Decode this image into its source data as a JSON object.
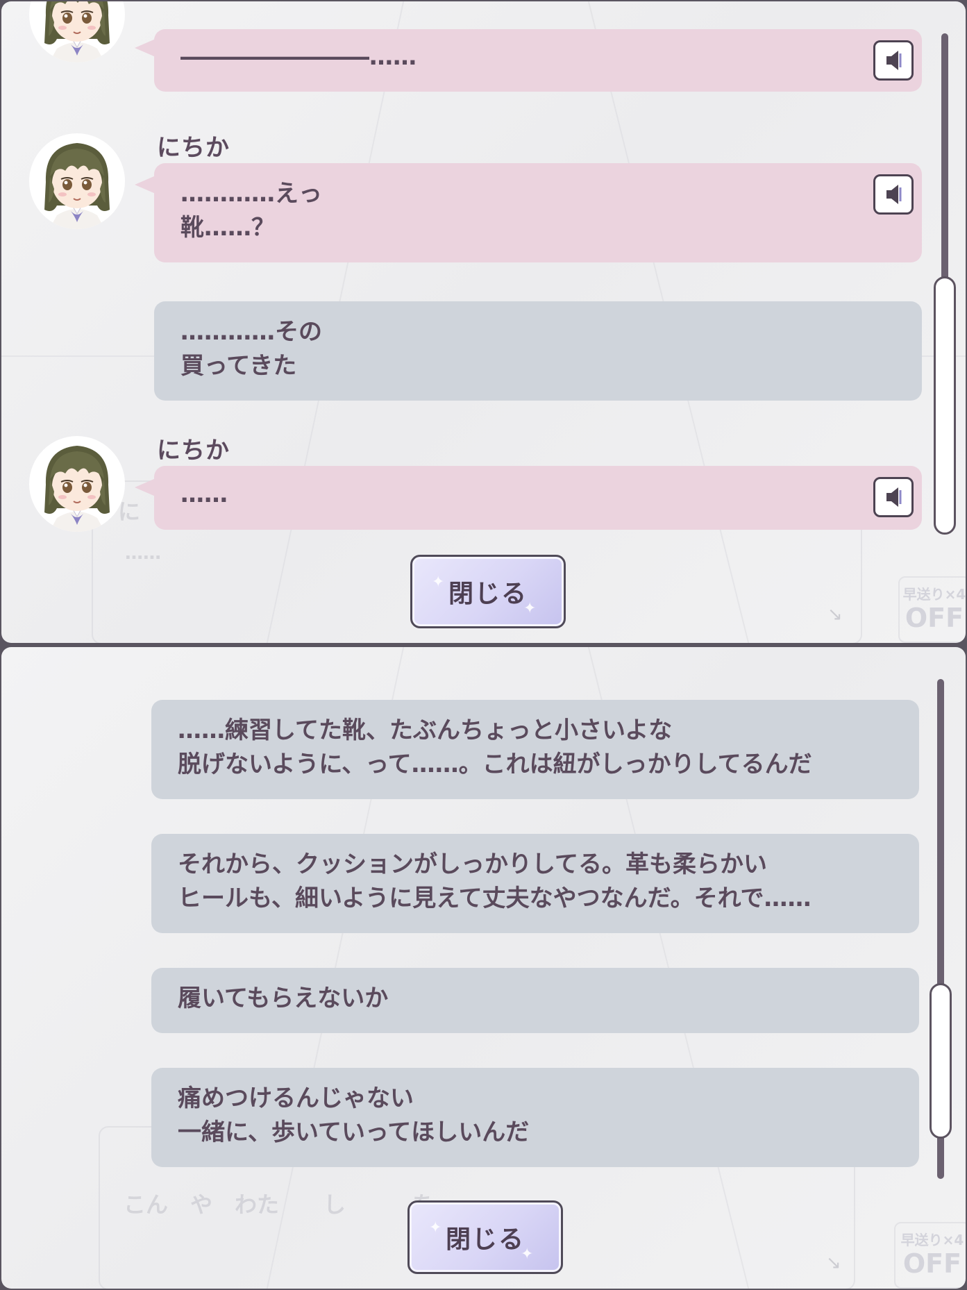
{
  "panels": [
    {
      "close_label": "閉じる",
      "bg": {
        "ghost_text": "……",
        "ghost_letter": "に",
        "ff_line1": "早送り×4",
        "ff_line2": "OFF",
        "arrow": "↘"
      },
      "messages": [
        {
          "lines": [
            "――――――――……"
          ],
          "speaker": ""
        },
        {
          "lines": [
            "…………えっ",
            "靴……？"
          ],
          "speaker": "にちか"
        },
        {
          "lines": [
            "…………その",
            "買ってきた"
          ],
          "speaker": ""
        },
        {
          "lines": [
            "……"
          ],
          "speaker": "にちか"
        }
      ]
    },
    {
      "close_label": "閉じる",
      "bg": {
        "ghost_text": "こん　や　わた　　し　　　を",
        "ff_line1": "早送り×4",
        "ff_line2": "OFF",
        "arrow": "↘"
      },
      "messages": [
        {
          "lines": [
            "……練習してた靴、たぶんちょっと小さいよな",
            "脱げないように、って……。これは紐がしっかりしてるんだ"
          ]
        },
        {
          "lines": [
            "それから、クッションがしっかりしてる。革も柔らかい",
            "ヒールも、細いように見えて丈夫なやつなんだ。それで……"
          ]
        },
        {
          "lines": [
            "履いてもらえないか"
          ]
        },
        {
          "lines": [
            "痛めつけるんじゃない",
            "一緒に、歩いていってほしいんだ"
          ]
        }
      ]
    }
  ],
  "icons": {
    "voice": "speaker-icon",
    "avatar": "character-avatar"
  },
  "colors": {
    "speaker_bubble": "#ebd3de",
    "narration_bubble": "#cfd4db",
    "text": "#5a4a5c",
    "scrollbar": "#6b6170",
    "close_button": "#d9d6f6"
  }
}
